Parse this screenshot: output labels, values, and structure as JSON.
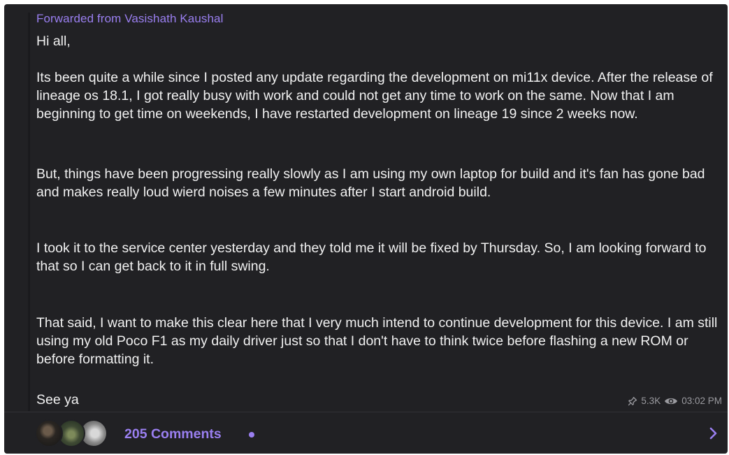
{
  "post": {
    "forwarded_from": "Forwarded from Vasishath Kaushal",
    "greeting": "Hi all,",
    "paragraphs": [
      "Its been quite a while since I posted any update regarding the development on mi11x device. After the release of lineage os 18.1, I got really busy with work and could not get any time to work on the same. Now that I am beginning to get time on weekends, I have restarted development on lineage 19 since 2 weeks now.",
      "But, things have been progressing really slowly as I am using my own laptop for build and it's fan has gone bad and makes really loud wierd noises a few minutes after I start android build.",
      " I took it to the service center yesterday and they told me it will be fixed by Thursday. So, I am looking forward to that so I can get back to it in full swing.",
      "That said, I want to make this clear here that I very much intend to continue development for this device. I am still using my old Poco F1 as my daily driver just so that I don't have to think twice before flashing a new ROM or before formatting it."
    ],
    "signoff": "See ya",
    "views": "5.3K",
    "time": "03:02 PM"
  },
  "footer": {
    "comments_label": "205 Comments"
  },
  "colors": {
    "background": "#212124",
    "accent": "#9a7ff0",
    "text": "#f1f1f1",
    "meta": "#9a9a9f"
  },
  "icons": {
    "pin": "pin-icon",
    "views": "eye-icon",
    "chevron": "chevron-right-icon"
  }
}
